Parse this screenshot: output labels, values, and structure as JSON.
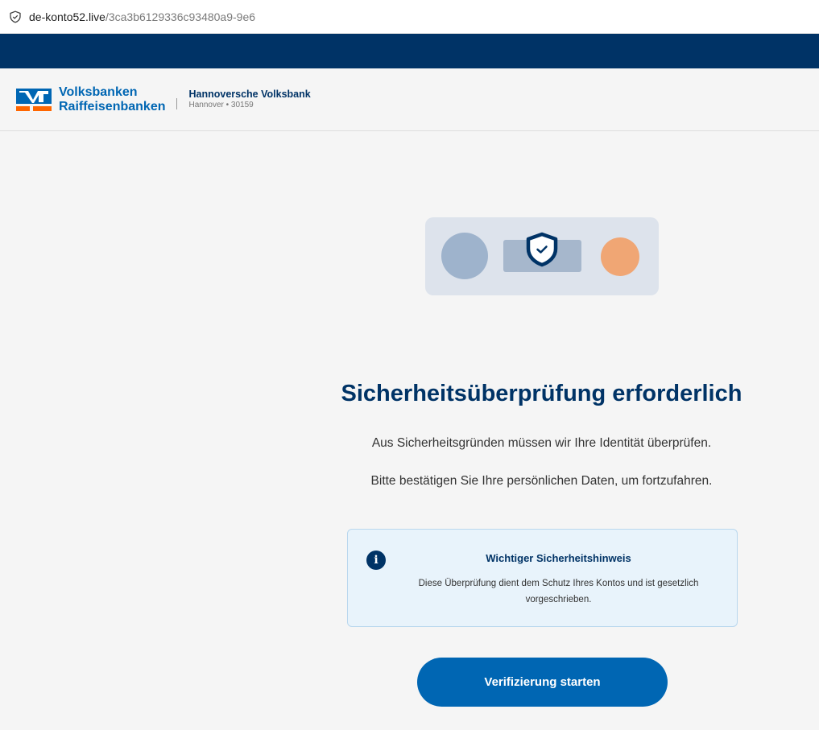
{
  "browser": {
    "url_host": "de-konto52.live",
    "url_path": "/3ca3b6129336c93480a9-9e6"
  },
  "header": {
    "brand_line1": "Volksbanken",
    "brand_line2": "Raiffeisenbanken",
    "bank_name": "Hannoversche Volksbank",
    "bank_location": "Hannover • 30159"
  },
  "main": {
    "title": "Sicherheitsüberprüfung erforderlich",
    "paragraph1": "Aus Sicherheitsgründen müssen wir Ihre Identität überprüfen.",
    "paragraph2": "Bitte bestätigen Sie Ihre persönlichen Daten, um fortzufahren."
  },
  "notice": {
    "icon_label": "i",
    "title": "Wichtiger Sicherheitshinweis",
    "text": "Diese Überprüfung dient dem Schutz Ihres Kontos und ist gesetzlich vorgeschrieben."
  },
  "cta": {
    "label": "Verifizierung starten"
  },
  "colors": {
    "navy": "#003366",
    "brand_blue": "#0066b3",
    "logo_orange": "#ff6600",
    "accent_orange": "#f0a674",
    "notice_bg": "#e8f3fb"
  },
  "icons": {
    "address_bar": "shield-check-icon",
    "illustration": "shield-check-icon",
    "notice": "info-icon"
  }
}
